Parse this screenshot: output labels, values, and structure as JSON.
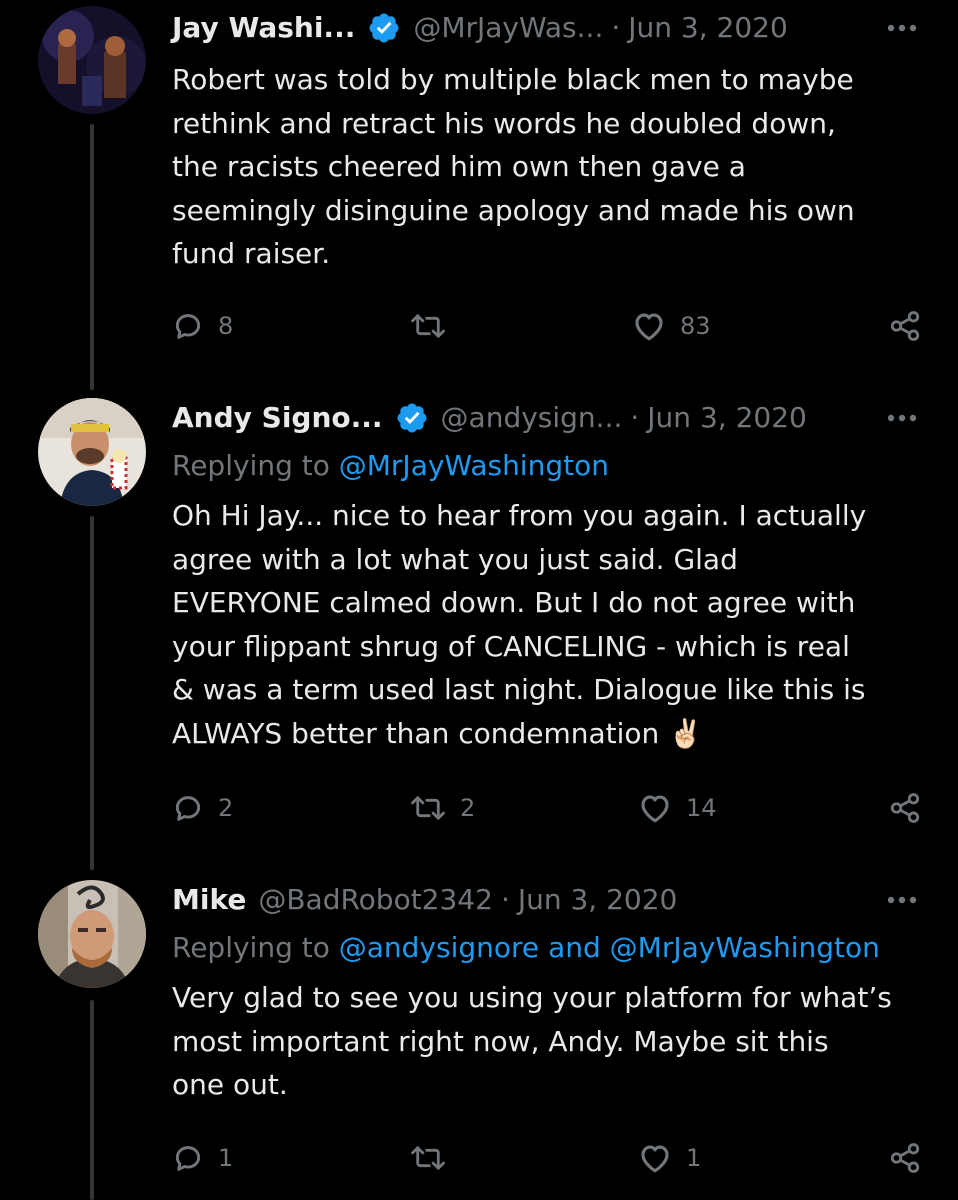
{
  "tweets": [
    {
      "name": "Jay Washi...",
      "verified": true,
      "handle": "@MrJayWas...",
      "separator": "·",
      "date": "Jun 3, 2020",
      "replying_prefix": "",
      "replying_mentions": [],
      "text": "Robert was told by multiple black men to maybe\nrethink and retract his words he doubled down,\nthe racists cheered him own then gave a\nseemingly disinguine apology and made his own\nfund raiser.",
      "reply_count": "8",
      "retweet_count": "",
      "like_count": "83"
    },
    {
      "name": "Andy Signo...",
      "verified": true,
      "handle": "@andysign...",
      "separator": "·",
      "date": "Jun 3, 2020",
      "replying_prefix": "Replying to",
      "replying_mentions": [
        "@MrJayWashington"
      ],
      "text": "Oh Hi Jay... nice to hear from you again. I actually\nagree with a lot what you just said. Glad\nEVERYONE calmed down. But I do not agree with\nyour flippant shrug of CANCELING - which is real\n& was a term used last night. Dialogue like this is\nALWAYS better than condemnation ✌🏻",
      "reply_count": "2",
      "retweet_count": "2",
      "like_count": "14"
    },
    {
      "name": "Mike",
      "verified": false,
      "handle": "@BadRobot2342",
      "separator": "·",
      "date": "Jun 3, 2020",
      "replying_prefix": "Replying to",
      "replying_mentions": [
        "@andysignore",
        "@MrJayWashington"
      ],
      "replying_joiner": "and",
      "text": "Very glad to see you using your platform for what’s\nmost important right now, Andy. Maybe sit this\none out.",
      "reply_count": "1",
      "retweet_count": "",
      "like_count": "1"
    }
  ],
  "icons": {
    "reply": "reply-icon",
    "retweet": "retweet-icon",
    "like": "heart-icon",
    "share": "share-icon",
    "more": "more-icon",
    "verified": "verified-badge-icon"
  },
  "colors": {
    "background": "#000000",
    "text": "#e7e9ea",
    "muted": "#71767b",
    "link": "#1d9bf0",
    "verified": "#1d9bf0",
    "thread_line": "#333639"
  }
}
